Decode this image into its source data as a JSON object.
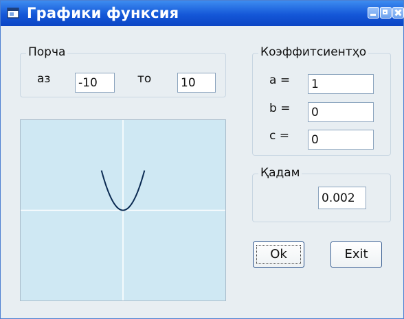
{
  "window": {
    "title": "Графики функсия"
  },
  "range_group": {
    "legend": "Порча",
    "from_label": "аз",
    "from_value": "-10",
    "to_label": "то",
    "to_value": "10"
  },
  "coeff_group": {
    "legend": "Коэффитсиентҳо",
    "a_label": "a =",
    "a_value": "1",
    "b_label": "b =",
    "b_value": "0",
    "c_label": "c =",
    "c_value": "0"
  },
  "step_group": {
    "legend": "Қадам",
    "step_value": "0.002"
  },
  "buttons": {
    "ok_label": "Ok",
    "exit_label": "Exit"
  },
  "colors": {
    "titlebar": "#1457d8",
    "plot_background": "#cfe8f3",
    "axis": "#ffffff",
    "curve": "#0a2a52"
  },
  "icons": {
    "window_icon": "app-window-icon",
    "minimize": "minimize-icon",
    "maximize": "maximize-icon",
    "close": "close-icon"
  },
  "chart_data": {
    "type": "line",
    "title": "",
    "xlabel": "",
    "ylabel": "",
    "function": "y = a*x^2 + b*x + c",
    "coefficients": {
      "a": 1,
      "b": 0,
      "c": 0
    },
    "x": [
      -2.1,
      -1.5,
      -1.0,
      -0.5,
      0,
      0.5,
      1.0,
      1.5,
      2.1
    ],
    "y": [
      4.41,
      2.25,
      1.0,
      0.25,
      0,
      0.25,
      1.0,
      2.25,
      4.41
    ],
    "xlim": [
      -10,
      10
    ],
    "ylim": [
      -10,
      10
    ],
    "grid": false
  }
}
